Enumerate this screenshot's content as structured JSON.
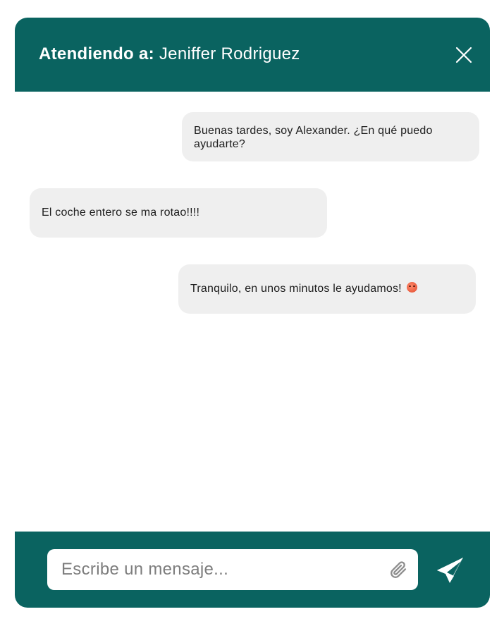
{
  "header": {
    "prefix": "Atendiendo a:",
    "name": " Jeniffer Rodriguez"
  },
  "messages": [
    {
      "text": "Buenas tardes, soy Alexander. ¿En qué puedo ayudarte?"
    },
    {
      "text": "El coche entero se ma rotao!!!!"
    },
    {
      "text": "Tranquilo, en unos minutos le ayudamos! ",
      "emoji": "hot-face-emoji"
    }
  ],
  "composer": {
    "placeholder": "Escribe un mensaje...",
    "value": ""
  },
  "icons": {
    "close": "close-icon",
    "attach": "paperclip-icon",
    "send": "paper-plane-icon"
  },
  "colors": {
    "brand": "#0a6360",
    "bubble": "#efefef",
    "header_text": "#ffffff"
  }
}
